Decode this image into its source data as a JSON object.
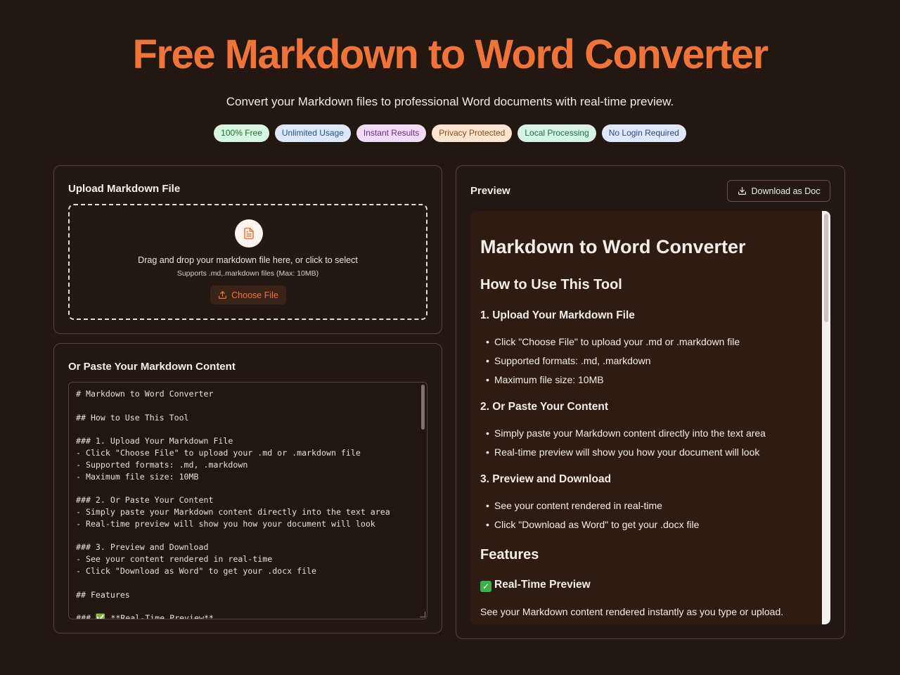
{
  "header": {
    "title": "Free Markdown to Word Converter",
    "subtitle": "Convert your Markdown files to professional Word documents with real-time preview."
  },
  "badges": [
    {
      "label": "100% Free",
      "bg": "#d7f5df",
      "fg": "#1f6b36"
    },
    {
      "label": "Unlimited Usage",
      "bg": "#dde9fb",
      "fg": "#2a4f8a"
    },
    {
      "label": "Instant Results",
      "bg": "#f1dcf7",
      "fg": "#6b2d84"
    },
    {
      "label": "Privacy Protected",
      "bg": "#fbe5d1",
      "fg": "#8a4a1e"
    },
    {
      "label": "Local Processing",
      "bg": "#d6f3e3",
      "fg": "#1e6b4a"
    },
    {
      "label": "No Login Required",
      "bg": "#dfe7fb",
      "fg": "#2d4785"
    }
  ],
  "upload": {
    "title": "Upload Markdown File",
    "icon": "file-icon",
    "drop_text": "Drag and drop your markdown file here, or click to select",
    "hint": "Supports .md,.markdown files (Max: 10MB)",
    "choose_label": "Choose File",
    "choose_icon": "upload-icon"
  },
  "paste": {
    "title": "Or Paste Your Markdown Content",
    "content": "# Markdown to Word Converter\n\n## How to Use This Tool\n\n### 1. Upload Your Markdown File\n- Click \"Choose File\" to upload your .md or .markdown file\n- Supported formats: .md, .markdown\n- Maximum file size: 10MB\n\n### 2. Or Paste Your Content\n- Simply paste your Markdown content directly into the text area\n- Real-time preview will show you how your document will look\n\n### 3. Preview and Download\n- See your content rendered in real-time\n- Click \"Download as Word\" to get your .docx file\n\n## Features\n\n### ✅ **Real-Time Preview**"
  },
  "preview": {
    "title": "Preview",
    "download_label": "Download as Doc",
    "download_icon": "download-icon",
    "h1": "Markdown to Word Converter",
    "h2_howto": "How to Use This Tool",
    "s1_title": "1. Upload Your Markdown File",
    "s1_items": [
      "Click \"Choose File\" to upload your .md or .markdown file",
      "Supported formats: .md, .markdown",
      "Maximum file size: 10MB"
    ],
    "s2_title": "2. Or Paste Your Content",
    "s2_items": [
      "Simply paste your Markdown content directly into the text area",
      "Real-time preview will show you how your document will look"
    ],
    "s3_title": "3. Preview and Download",
    "s3_items": [
      "See your content rendered in real-time",
      "Click \"Download as Word\" to get your .docx file"
    ],
    "h2_features": "Features",
    "f1_title": "Real-Time Preview",
    "f1_icon": "check-icon",
    "f1_text": "See your Markdown content rendered instantly as you type or upload."
  }
}
